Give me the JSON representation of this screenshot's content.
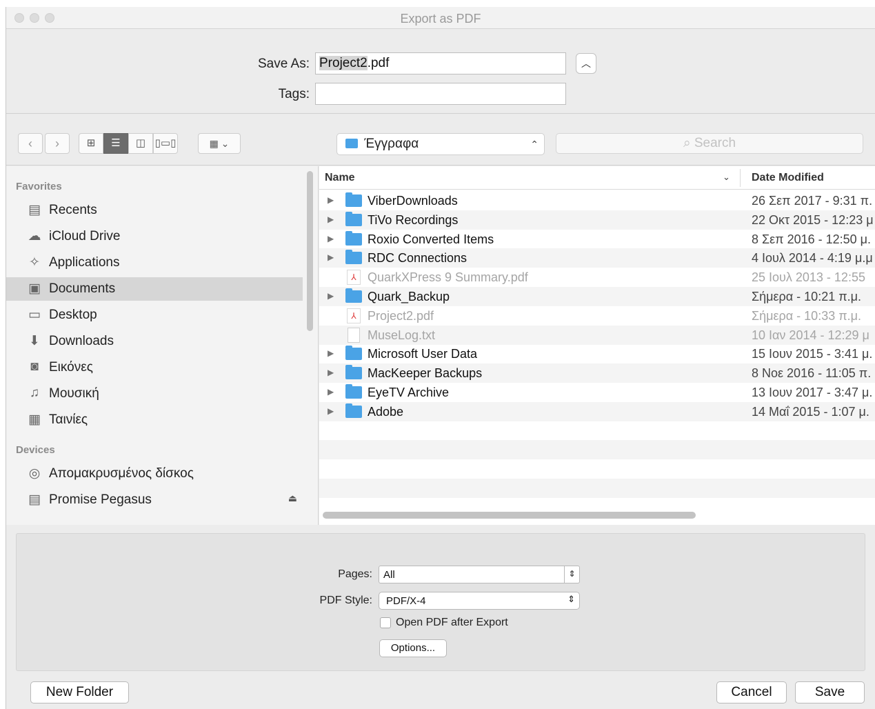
{
  "window": {
    "title": "Export as PDF"
  },
  "save_as": {
    "label": "Save As:",
    "value": "Project2.pdf",
    "selected_part": "Project2",
    "extension": ".pdf"
  },
  "tags": {
    "label": "Tags:",
    "value": ""
  },
  "toolbar": {
    "back_glyph": "‹",
    "forward_glyph": "›",
    "view_modes": [
      "icon-view",
      "list-view",
      "column-view",
      "coverflow-view"
    ],
    "active_view": "list-view",
    "location": "Έγγραφα",
    "search_placeholder": "Search"
  },
  "sidebar": {
    "favorites_title": "Favorites",
    "favorites": [
      {
        "label": "Recents",
        "icon": "recents-icon",
        "glyph": "▤"
      },
      {
        "label": "iCloud Drive",
        "icon": "cloud-icon",
        "glyph": "☁"
      },
      {
        "label": "Applications",
        "icon": "applications-icon",
        "glyph": "✧"
      },
      {
        "label": "Documents",
        "icon": "documents-icon",
        "glyph": "▣",
        "selected": true
      },
      {
        "label": "Desktop",
        "icon": "desktop-icon",
        "glyph": "▭"
      },
      {
        "label": "Downloads",
        "icon": "downloads-icon",
        "glyph": "⬇"
      },
      {
        "label": "Εικόνες",
        "icon": "camera-icon",
        "glyph": "◙"
      },
      {
        "label": "Μουσική",
        "icon": "music-icon",
        "glyph": "♫"
      },
      {
        "label": "Ταινίες",
        "icon": "film-icon",
        "glyph": "▦"
      }
    ],
    "devices_title": "Devices",
    "devices": [
      {
        "label": "Απομακρυσμένος δίσκος",
        "icon": "disc-icon",
        "glyph": "◎"
      },
      {
        "label": "Promise Pegasus",
        "icon": "drive-icon",
        "glyph": "▤",
        "eject": true
      }
    ]
  },
  "filelist": {
    "col_name": "Name",
    "col_date": "Date Modified",
    "rows": [
      {
        "name": "ViberDownloads",
        "date": "26 Σεπ 2017 - 9:31 π.",
        "type": "folder"
      },
      {
        "name": "TiVo Recordings",
        "date": "22 Οκτ 2015 - 12:23 μ",
        "type": "folder"
      },
      {
        "name": "Roxio Converted Items",
        "date": "8 Σεπ 2016 - 12:50 μ.",
        "type": "folder"
      },
      {
        "name": "RDC Connections",
        "date": "4 Ιουλ 2014 - 4:19 μ.μ",
        "type": "folder"
      },
      {
        "name": "QuarkXPress 9 Summary.pdf",
        "date": "25 Ιουλ 2013 - 12:55",
        "type": "pdf"
      },
      {
        "name": "Quark_Backup",
        "date": "Σήμερα - 10:21 π.μ.",
        "type": "folder"
      },
      {
        "name": "Project2.pdf",
        "date": "Σήμερα - 10:33 π.μ.",
        "type": "pdf"
      },
      {
        "name": "MuseLog.txt",
        "date": "10 Ιαν 2014 - 12:29 μ",
        "type": "txt"
      },
      {
        "name": "Microsoft User Data",
        "date": "15 Ιουν 2015 - 3:41 μ.",
        "type": "folder"
      },
      {
        "name": "MacKeeper Backups",
        "date": "8 Νοε 2016 - 11:05 π.",
        "type": "folder"
      },
      {
        "name": "EyeTV Archive",
        "date": "13 Ιουν 2017 - 3:47 μ.",
        "type": "folder"
      },
      {
        "name": "Adobe",
        "date": "14 Μαΐ 2015 - 1:07 μ.",
        "type": "folder"
      }
    ]
  },
  "options": {
    "pages_label": "Pages:",
    "pages_value": "All",
    "style_label": "PDF Style:",
    "style_value": "PDF/X-4",
    "open_after_label": "Open PDF after Export",
    "open_after_checked": false,
    "options_button": "Options..."
  },
  "footer": {
    "new_folder": "New Folder",
    "cancel": "Cancel",
    "save": "Save"
  }
}
